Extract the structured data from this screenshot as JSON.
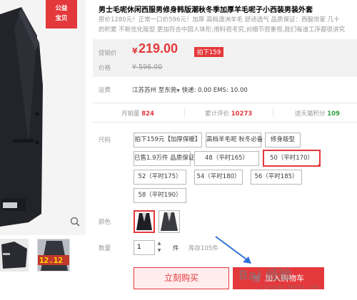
{
  "badge": {
    "line1": "公益",
    "line2": "宝贝"
  },
  "thumb_b_text": "12.12",
  "product": {
    "title": "男士毛呢休闲西服男修身韩版潮秋冬季加厚羊毛呢子小西装男装外套",
    "subtitle_line1": "原价1280元！正常一口价596元！加厚 高档澳洲羊毛   舒适透气   品质保证：西服世家 几十",
    "subtitle_line2": "的积累 不断优化版型 更加符合中国人体形;用料很考究,对细节很重视,我们每道工序都很讲究"
  },
  "price": {
    "label": "促销价",
    "currency": "¥",
    "value": "219.00",
    "promo_tag": "拍下159",
    "orig_label": "价格",
    "orig_value": "¥ 596.00"
  },
  "shipping": {
    "label": "运费",
    "from": "江苏苏州",
    "to_prefix": "至",
    "to": "东莞",
    "arrow": "▼",
    "fees": "快递: 0.00 EMS: 10.00"
  },
  "stats": {
    "monthly_label": "月销量",
    "monthly_value": "824",
    "reviews_label": "累计评价",
    "reviews_value": "10273",
    "points_label": "送天猫积分",
    "points_value": "109"
  },
  "size": {
    "label": "尺码",
    "options": [
      "拍下159元【加厚保暖】",
      "高档羊毛呢 秋冬必备",
      "修身版型",
      "已售1.9万件 品质保证",
      "48（平时165）",
      "50（平时170）",
      "52（平时175）",
      "54（平时180）",
      "56（平时185）",
      "58（平时190）"
    ],
    "selected": "50（平时170）"
  },
  "color": {
    "label": "颜色"
  },
  "quantity": {
    "label": "数量",
    "value": "1",
    "unit": "件",
    "stock": "库存105件"
  },
  "actions": {
    "buy_now": "立刻购买",
    "add_cart": "加入购物车"
  },
  "watermark": {
    "text": "Bai 经验",
    "url": "jingyan.baidu.com"
  },
  "colors": {
    "accent": "#e4393c",
    "points_green": "#2a9d3a",
    "price_bg": "#f2f2f2"
  }
}
